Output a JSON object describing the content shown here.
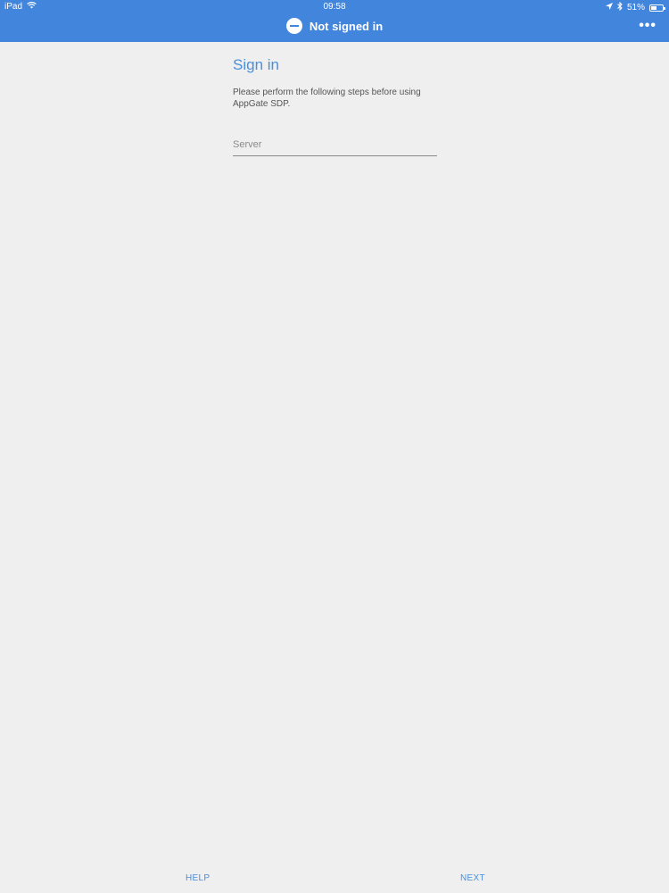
{
  "status_bar": {
    "device": "iPad",
    "time": "09:58",
    "battery_percent": "51%",
    "battery_level": 0.51,
    "icons": [
      "wifi-icon",
      "location-arrow-icon",
      "bluetooth-icon",
      "battery-icon"
    ]
  },
  "header": {
    "title": "Not signed in",
    "status_icon": "not-signed-in-icon",
    "menu_icon": "more-options-icon",
    "menu_label": "•••"
  },
  "main": {
    "heading": "Sign in",
    "description": "Please perform the following steps before using AppGate SDP.",
    "server_field": {
      "placeholder": "Server",
      "value": ""
    }
  },
  "footer": {
    "help_label": "HELP",
    "next_label": "NEXT"
  },
  "colors": {
    "accent": "#4285dc",
    "link": "#4a8fdd",
    "background": "#efefef"
  }
}
